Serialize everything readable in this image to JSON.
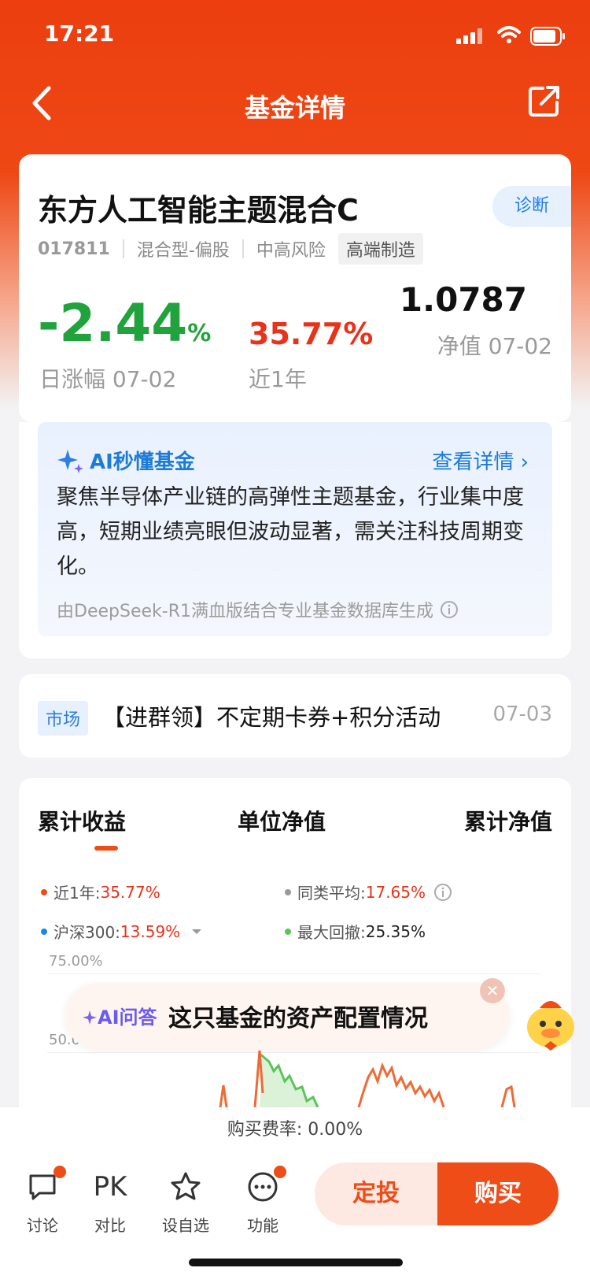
{
  "status": {
    "time": "17:21"
  },
  "navbar": {
    "title": "基金详情"
  },
  "fund": {
    "name": "东方人工智能主题混合C",
    "diagnose": "诊断",
    "code": "017811",
    "type": "混合型-偏股",
    "risk": "中高风险",
    "tag": "高端制造",
    "daily_change_value": "-2.44",
    "daily_change_unit": "%",
    "daily_change_label": "日涨幅 07-02",
    "year_return": "35.77%",
    "year_label": "近1年",
    "nav": "1.0787",
    "nav_label": "净值 07-02"
  },
  "ai": {
    "title": "AI秒懂基金",
    "detail": "查看详情 ›",
    "text": "聚焦半导体产业链的高弹性主题基金，行业集中度高，短期业绩亮眼但波动显著，需关注科技周期变化。",
    "footer": "由DeepSeek-R1满血版结合专业基金数据库生成"
  },
  "news": {
    "tag": "市场",
    "text": "【进群领】不定期卡券+积分活动",
    "date": "07-03"
  },
  "chart_tabs": [
    "累计收益",
    "单位净值",
    "累计净值"
  ],
  "legend": {
    "l1_label": "近1年:",
    "l1_value": "35.77%",
    "l2_label": "同类平均:",
    "l2_value": "17.65%",
    "l3_label": "沪深300:",
    "l3_value": "13.59%",
    "l4_label": "最大回撤:",
    "l4_value": "25.35%"
  },
  "axis": {
    "y1": "75.00%",
    "y2": "50.00%"
  },
  "colors": {
    "accent": "#ef4d17",
    "up": "#e8321a",
    "down": "#20a33c",
    "link": "#1c7bd6"
  },
  "ai_float": {
    "label": "AI问答",
    "question": "这只基金的资产配置情况"
  },
  "fee": {
    "text": "购买费率:  0.00%"
  },
  "bottom": {
    "discuss": "讨论",
    "compare_icon": "PK",
    "compare": "对比",
    "watch": "设自选",
    "func": "功能",
    "ding": "定投",
    "buy": "购买"
  }
}
